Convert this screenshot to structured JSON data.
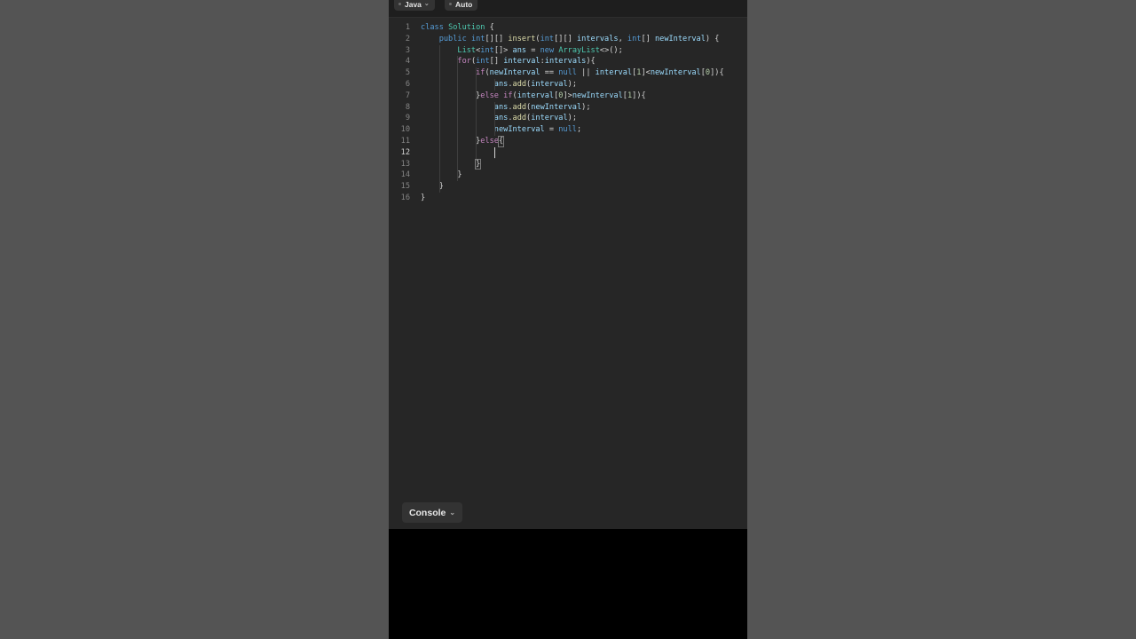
{
  "toolbar": {
    "language_label": "Java",
    "mode_label": "Auto"
  },
  "editor": {
    "active_line": 12,
    "lines": [
      {
        "n": "1",
        "tokens": [
          [
            "kw",
            "class"
          ],
          [
            "pl",
            " "
          ],
          [
            "ty",
            "Solution"
          ],
          [
            "pl",
            " {"
          ]
        ]
      },
      {
        "n": "2",
        "tokens": [
          [
            "pl",
            "    "
          ],
          [
            "kw",
            "public"
          ],
          [
            "pl",
            " "
          ],
          [
            "kw",
            "int"
          ],
          [
            "pl",
            "[][] "
          ],
          [
            "fn",
            "insert"
          ],
          [
            "pl",
            "("
          ],
          [
            "kw",
            "int"
          ],
          [
            "pl",
            "[][] "
          ],
          [
            "var",
            "intervals"
          ],
          [
            "pl",
            ", "
          ],
          [
            "kw",
            "int"
          ],
          [
            "pl",
            "[] "
          ],
          [
            "var",
            "newInterval"
          ],
          [
            "pl",
            ") {"
          ]
        ]
      },
      {
        "n": "3",
        "tokens": [
          [
            "pl",
            "        "
          ],
          [
            "ty",
            "List"
          ],
          [
            "pl",
            "<"
          ],
          [
            "kw",
            "int"
          ],
          [
            "pl",
            "[]> "
          ],
          [
            "var",
            "ans"
          ],
          [
            "pl",
            " = "
          ],
          [
            "kw",
            "new"
          ],
          [
            "pl",
            " "
          ],
          [
            "ty",
            "ArrayList"
          ],
          [
            "pl",
            "<>();"
          ]
        ]
      },
      {
        "n": "4",
        "tokens": [
          [
            "pl",
            "        "
          ],
          [
            "ctl",
            "for"
          ],
          [
            "pl",
            "("
          ],
          [
            "kw",
            "int"
          ],
          [
            "pl",
            "[] "
          ],
          [
            "var",
            "interval"
          ],
          [
            "pl",
            ":"
          ],
          [
            "var",
            "intervals"
          ],
          [
            "pl",
            "){"
          ]
        ]
      },
      {
        "n": "5",
        "tokens": [
          [
            "pl",
            "            "
          ],
          [
            "ctl",
            "if"
          ],
          [
            "pl",
            "("
          ],
          [
            "var",
            "newInterval"
          ],
          [
            "pl",
            " == "
          ],
          [
            "kw",
            "null"
          ],
          [
            "pl",
            " || "
          ],
          [
            "var",
            "interval"
          ],
          [
            "pl",
            "["
          ],
          [
            "num",
            "1"
          ],
          [
            "pl",
            "]<"
          ],
          [
            "var",
            "newInterval"
          ],
          [
            "pl",
            "["
          ],
          [
            "num",
            "0"
          ],
          [
            "pl",
            "]){"
          ]
        ]
      },
      {
        "n": "6",
        "tokens": [
          [
            "pl",
            "                "
          ],
          [
            "var",
            "ans"
          ],
          [
            "pl",
            "."
          ],
          [
            "fn",
            "add"
          ],
          [
            "pl",
            "("
          ],
          [
            "var",
            "interval"
          ],
          [
            "pl",
            ");"
          ]
        ]
      },
      {
        "n": "7",
        "tokens": [
          [
            "pl",
            "            }"
          ],
          [
            "ctl",
            "else"
          ],
          [
            "pl",
            " "
          ],
          [
            "ctl",
            "if"
          ],
          [
            "pl",
            "("
          ],
          [
            "var",
            "interval"
          ],
          [
            "pl",
            "["
          ],
          [
            "num",
            "0"
          ],
          [
            "pl",
            "]>"
          ],
          [
            "var",
            "newInterval"
          ],
          [
            "pl",
            "["
          ],
          [
            "num",
            "1"
          ],
          [
            "pl",
            "]){"
          ]
        ]
      },
      {
        "n": "8",
        "tokens": [
          [
            "pl",
            "                "
          ],
          [
            "var",
            "ans"
          ],
          [
            "pl",
            "."
          ],
          [
            "fn",
            "add"
          ],
          [
            "pl",
            "("
          ],
          [
            "var",
            "newInterval"
          ],
          [
            "pl",
            ");"
          ]
        ]
      },
      {
        "n": "9",
        "tokens": [
          [
            "pl",
            "                "
          ],
          [
            "var",
            "ans"
          ],
          [
            "pl",
            "."
          ],
          [
            "fn",
            "add"
          ],
          [
            "pl",
            "("
          ],
          [
            "var",
            "interval"
          ],
          [
            "pl",
            ");"
          ]
        ]
      },
      {
        "n": "10",
        "tokens": [
          [
            "pl",
            "                "
          ],
          [
            "var",
            "newInterval"
          ],
          [
            "pl",
            " = "
          ],
          [
            "kw",
            "null"
          ],
          [
            "pl",
            ";"
          ]
        ]
      },
      {
        "n": "11",
        "tokens": [
          [
            "pl",
            "            }"
          ],
          [
            "ctl",
            "else"
          ],
          [
            "pl",
            "{"
          ]
        ]
      },
      {
        "n": "12",
        "tokens": [
          [
            "pl",
            ""
          ]
        ]
      },
      {
        "n": "13",
        "tokens": [
          [
            "pl",
            "            }"
          ]
        ]
      },
      {
        "n": "14",
        "tokens": [
          [
            "pl",
            "        }"
          ]
        ]
      },
      {
        "n": "15",
        "tokens": [
          [
            "pl",
            "    }"
          ]
        ]
      },
      {
        "n": "16",
        "tokens": [
          [
            "pl",
            "}"
          ]
        ]
      }
    ]
  },
  "console": {
    "label": "Console"
  }
}
